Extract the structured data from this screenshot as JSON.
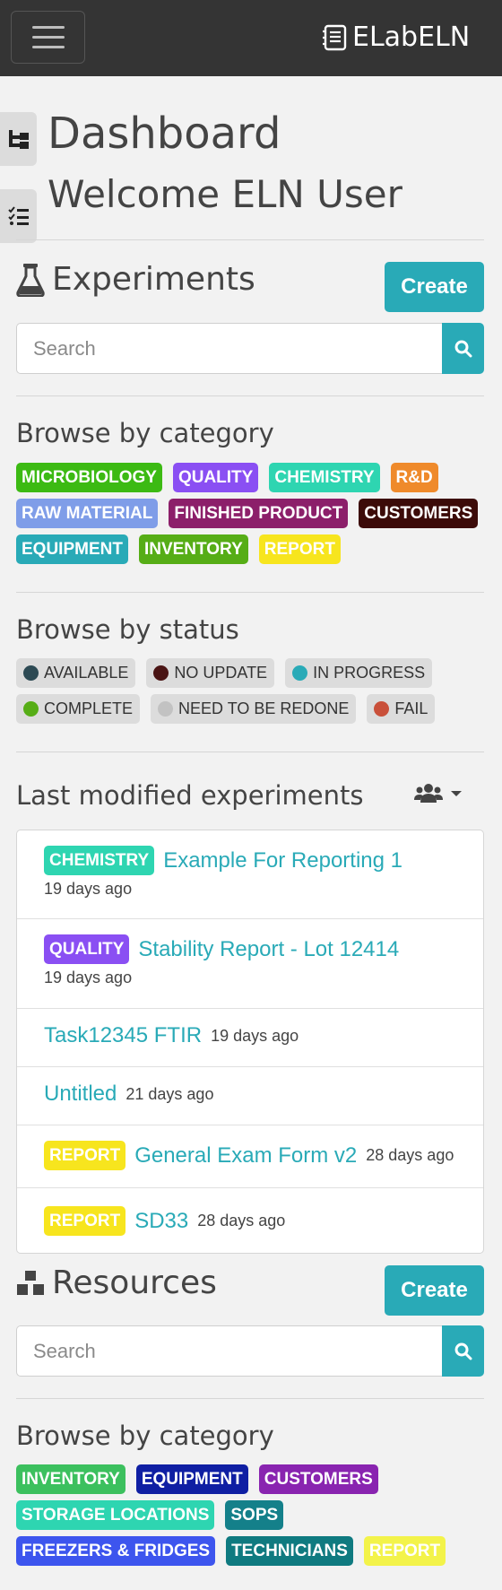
{
  "navbar": {
    "brand": "ELabELN"
  },
  "header": {
    "title": "Dashboard",
    "welcome": "Welcome ELN User"
  },
  "experiments": {
    "title": "Experiments",
    "create_label": "Create",
    "search_placeholder": "Search",
    "browse_category_title": "Browse by category",
    "categories": [
      {
        "label": "MICROBIOLOGY",
        "color": "#3cba13"
      },
      {
        "label": "QUALITY",
        "color": "#8a4ff3"
      },
      {
        "label": "CHEMISTRY",
        "color": "#2ed5b1"
      },
      {
        "label": "R&D",
        "color": "#ef8a2b"
      },
      {
        "label": "RAW MATERIAL",
        "color": "#7f9de8"
      },
      {
        "label": "FINISHED PRODUCT",
        "color": "#8c1f6a"
      },
      {
        "label": "CUSTOMERS",
        "color": "#3c0b09"
      },
      {
        "label": "EQUIPMENT",
        "color": "#29aab7"
      },
      {
        "label": "INVENTORY",
        "color": "#56ad16"
      },
      {
        "label": "REPORT",
        "color": "#f7e51e"
      }
    ],
    "browse_status_title": "Browse by status",
    "statuses": [
      {
        "label": "AVAILABLE",
        "color": "#2d4a54"
      },
      {
        "label": "NO UPDATE",
        "color": "#4a1414"
      },
      {
        "label": "IN PROGRESS",
        "color": "#29aab7"
      },
      {
        "label": "COMPLETE",
        "color": "#56ad16"
      },
      {
        "label": "NEED TO BE REDONE",
        "color": "#c2c2c2"
      },
      {
        "label": "FAIL",
        "color": "#c9503a"
      }
    ],
    "last_modified_title": "Last modified experiments",
    "recent": [
      {
        "badge": "CHEMISTRY",
        "badge_color": "#2ed5b1",
        "title": "Example For Reporting 1",
        "ago": "19 days ago"
      },
      {
        "badge": "QUALITY",
        "badge_color": "#8a4ff3",
        "title": "Stability Report - Lot 12414",
        "ago": "19 days ago"
      },
      {
        "badge": "",
        "badge_color": "",
        "title": "Task12345 FTIR",
        "ago": "19 days ago"
      },
      {
        "badge": "",
        "badge_color": "",
        "title": "Untitled",
        "ago": "21 days ago"
      },
      {
        "badge": "REPORT",
        "badge_color": "#f7e51e",
        "title": "General Exam Form v2",
        "ago": "28 days ago"
      },
      {
        "badge": "REPORT",
        "badge_color": "#f7e51e",
        "title": "SD33",
        "ago": "28 days ago"
      }
    ]
  },
  "resources": {
    "title": "Resources",
    "create_label": "Create",
    "search_placeholder": "Search",
    "browse_category_title": "Browse by category",
    "categories": [
      {
        "label": "INVENTORY",
        "color": "#3cc05e"
      },
      {
        "label": "EQUIPMENT",
        "color": "#0f1fa3"
      },
      {
        "label": "CUSTOMERS",
        "color": "#8924b0"
      },
      {
        "label": "STORAGE LOCATIONS",
        "color": "#2ed5b1"
      },
      {
        "label": "SOPS",
        "color": "#14808a"
      },
      {
        "label": "FREEZERS & FRIDGES",
        "color": "#3d55ee"
      },
      {
        "label": "TECHNICIANS",
        "color": "#0f7a80"
      },
      {
        "label": "REPORT",
        "color": "#f3f34a"
      }
    ]
  },
  "accent": "#29aab7"
}
